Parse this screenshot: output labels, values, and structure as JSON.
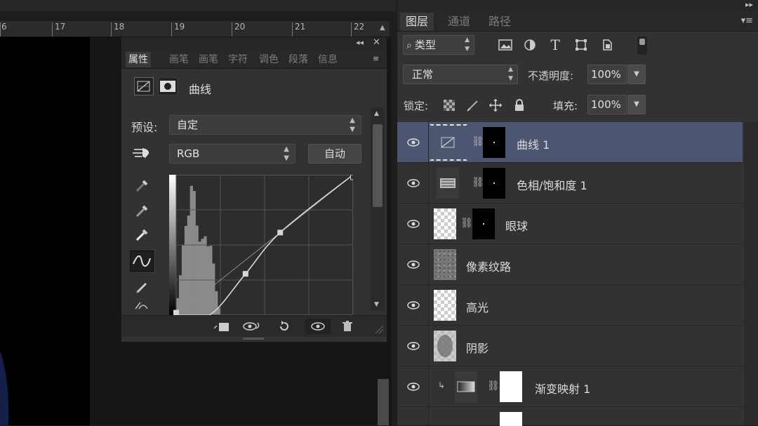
{
  "ruler": {
    "ticks": [
      "6",
      "17",
      "18",
      "19",
      "20",
      "21",
      "22"
    ]
  },
  "properties": {
    "tabs": [
      "属性",
      "画笔",
      "画笔",
      "字符",
      "调色",
      "段落",
      "信息"
    ],
    "adjustment_title": "曲线",
    "preset_label": "预设:",
    "preset_value": "自定",
    "channel_value": "RGB",
    "auto_button": "自动",
    "curve": {
      "input_range": [
        0,
        255
      ],
      "output_range": [
        0,
        255
      ],
      "points": [
        [
          0,
          0
        ],
        [
          48,
          0
        ],
        [
          100,
          75
        ],
        [
          150,
          150
        ],
        [
          255,
          255
        ]
      ],
      "grid_divisions": 4,
      "histogram_colors": {
        "bars": "#8a8a8a",
        "line": "#d6d6d6",
        "grid": "#555555"
      }
    }
  },
  "layers": {
    "tabs": [
      "图层",
      "通道",
      "路径"
    ],
    "filter_kind": "类型",
    "blend_mode": "正常",
    "opacity_label": "不透明度:",
    "opacity_value": "100%",
    "lock_label": "锁定:",
    "fill_label": "填充:",
    "fill_value": "100%",
    "selected_color": "#4d5671",
    "items": [
      {
        "name": "曲线 1"
      },
      {
        "name": "色相/饱和度 1"
      },
      {
        "name": "眼球"
      },
      {
        "name": "像素纹路"
      },
      {
        "name": "高光"
      },
      {
        "name": "阴影"
      },
      {
        "name": "渐变映射 1"
      }
    ]
  }
}
